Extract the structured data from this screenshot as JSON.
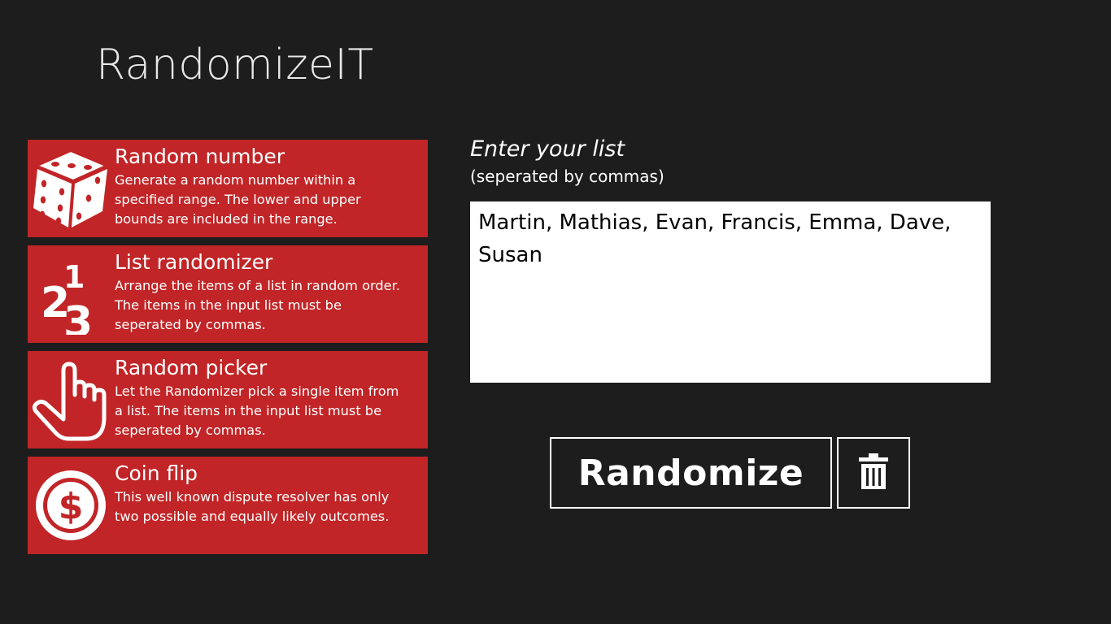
{
  "app": {
    "title": "RandomizeIT"
  },
  "tiles": [
    {
      "title": "Random number",
      "description": "Generate a random number within a specified range. The lower and upper bounds are included in the range.",
      "icon": "dice-icon"
    },
    {
      "title": "List randomizer",
      "description": "Arrange the items of a list in random order. The items in the input list must be seperated by commas.",
      "icon": "numbers-123-icon"
    },
    {
      "title": "Random picker",
      "description": "Let the Randomizer pick a single item from a list. The items in the input list must be seperated by commas.",
      "icon": "pointing-hand-icon"
    },
    {
      "title": "Coin flip",
      "description": "This well known dispute resolver has only two possible and equally likely outcomes.",
      "icon": "coin-dollar-icon"
    }
  ],
  "list_panel": {
    "heading": "Enter your list",
    "subheading": "(seperated by commas)",
    "value": "Martin, Mathias, Evan, Francis, Emma, Dave, Susan"
  },
  "actions": {
    "randomize_label": "Randomize",
    "clear_icon": "trash-icon"
  },
  "colors": {
    "background": "#1d1d1d",
    "tile": "#c12527",
    "text": "#ffffff"
  }
}
